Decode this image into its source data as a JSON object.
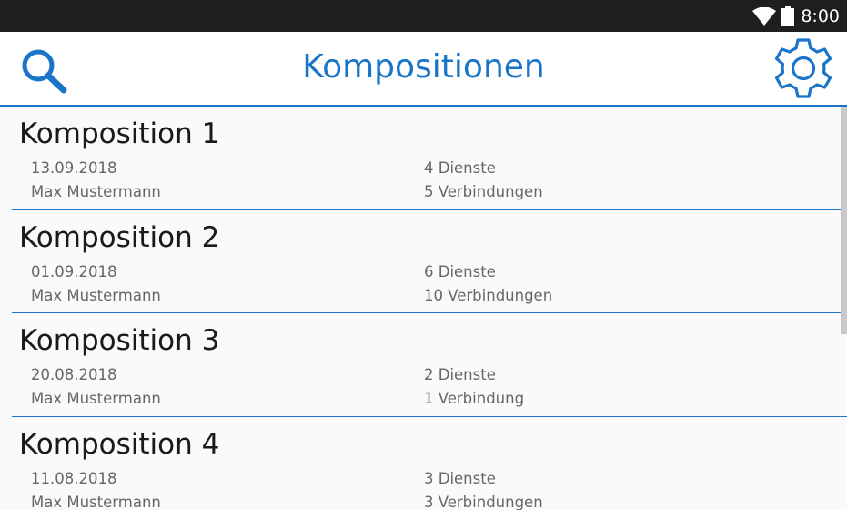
{
  "status_bar": {
    "time": "8:00",
    "icons": [
      "wifi-icon",
      "battery-icon"
    ]
  },
  "app_bar": {
    "title": "Kompositionen",
    "search_icon": "search-icon",
    "settings_icon": "gear-icon",
    "accent_color": "#1a75c9"
  },
  "compositions": [
    {
      "name": "Komposition 1",
      "date": "13.09.2018",
      "author": "Max Mustermann",
      "services": "4 Dienste",
      "connections": "5 Verbindungen"
    },
    {
      "name": "Komposition 2",
      "date": "01.09.2018",
      "author": "Max Mustermann",
      "services": "6 Dienste",
      "connections": "10 Verbindungen"
    },
    {
      "name": "Komposition 3",
      "date": "20.08.2018",
      "author": "Max Mustermann",
      "services": "2 Dienste",
      "connections": "1 Verbindung"
    },
    {
      "name": "Komposition 4",
      "date": "11.08.2018",
      "author": "Max Mustermann",
      "services": "3 Dienste",
      "connections": "3 Verbindungen"
    }
  ]
}
